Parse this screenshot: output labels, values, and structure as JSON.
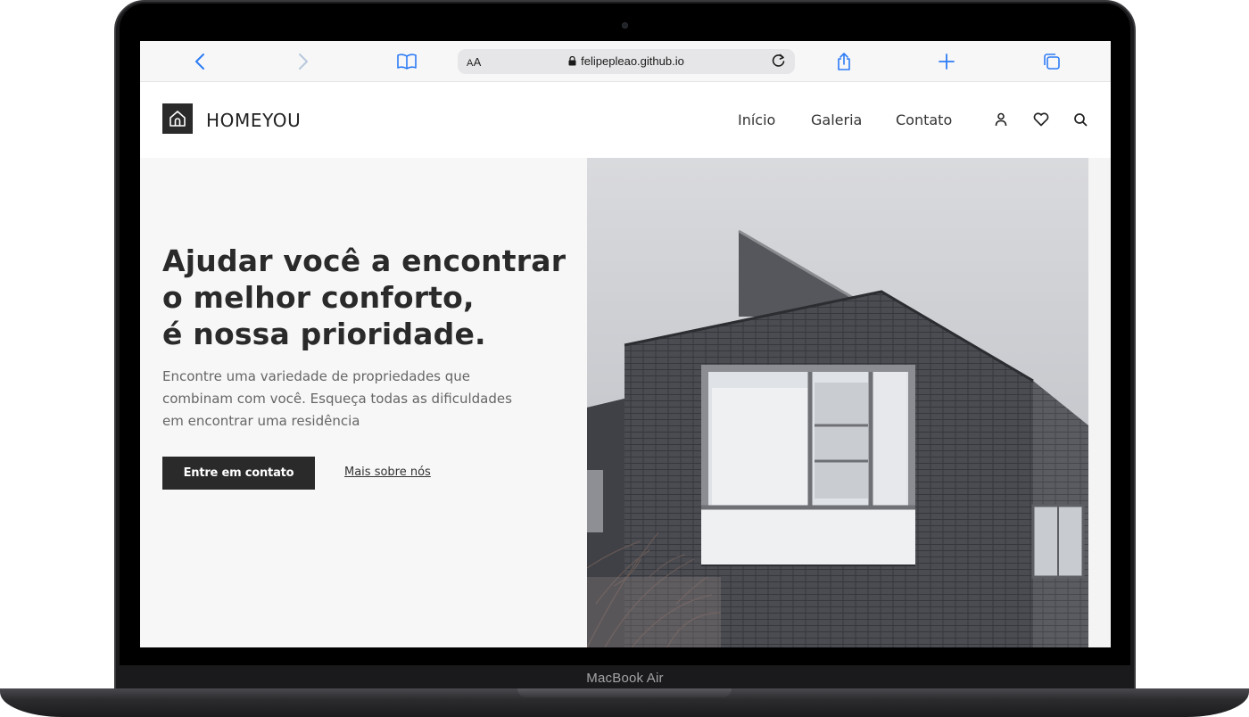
{
  "browser": {
    "url": "felipepleao.github.io",
    "text_size_label_small": "A",
    "text_size_label_big": "A"
  },
  "site": {
    "brand": "HOMEYOU",
    "nav": [
      "Início",
      "Galeria",
      "Contato"
    ],
    "icons": [
      "user-icon",
      "heart-icon",
      "search-icon"
    ]
  },
  "hero": {
    "title_lines": [
      "Ajudar você a encontrar",
      "o melhor conforto,",
      "é nossa prioridade."
    ],
    "subtitle_lines": [
      "Encontre uma variedade de propriedades que",
      "combinam com você. Esqueça todas as dificuldades",
      "em encontrar uma residência"
    ],
    "primary_button": "Entre em contato",
    "secondary_link": "Mais sobre nós"
  },
  "device": {
    "label": "MacBook Air"
  },
  "colors": {
    "accent_blue": "#2d7cf6",
    "dark": "#2a2a2a",
    "hero_bg": "#f7f7f7"
  }
}
